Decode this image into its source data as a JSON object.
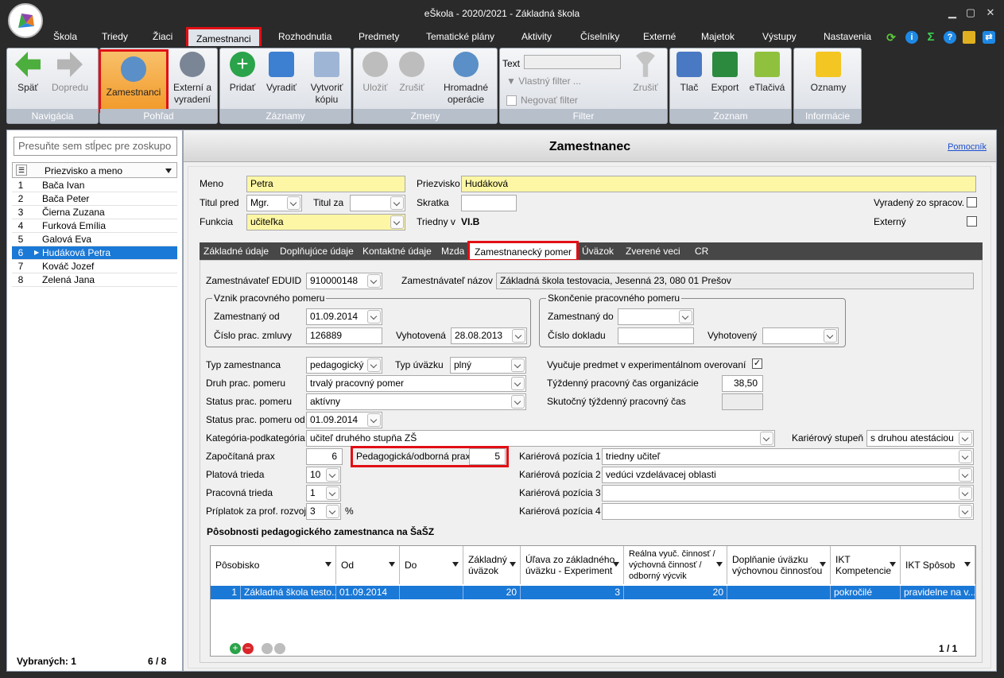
{
  "app": {
    "title": "eŠkola - 2020/2021 - Základná škola"
  },
  "menu": {
    "items": [
      "Škola",
      "Triedy",
      "Žiaci",
      "Zamestnanci",
      "Rozhodnutia",
      "Predmety",
      "Tematické plány",
      "Aktivity",
      "Číselníky",
      "Externé",
      "Majetok",
      "Výstupy",
      "Nastavenia"
    ],
    "active": "Zamestnanci"
  },
  "ribbon": {
    "navigacia": {
      "caption": "Navigácia",
      "back": "Späť",
      "forward": "Dopredu"
    },
    "pohlad": {
      "caption": "Pohľad",
      "employees": "Zamestnanci",
      "external": "Externí a vyradení"
    },
    "zaznamy": {
      "caption": "Záznamy",
      "add": "Pridať",
      "remove": "Vyradiť",
      "copy": "Vytvoriť kópiu"
    },
    "zmeny": {
      "caption": "Zmeny",
      "save": "Uložiť",
      "cancel": "Zrušiť",
      "bulk": "Hromadné operácie"
    },
    "filter": {
      "caption": "Filter",
      "text_label": "Text",
      "custom": "Vlastný filter ...",
      "negate": "Negovať filter",
      "clear": "Zrušiť"
    },
    "zoznam": {
      "caption": "Zoznam",
      "print": "Tlač",
      "export": "Export",
      "eprint": "eTlačivá"
    },
    "informacie": {
      "caption": "Informácie",
      "notices": "Oznamy"
    }
  },
  "left": {
    "group_placeholder": "Presuňte sem stĺpec pre zoskupo",
    "col_header": "Priezvisko a meno",
    "rows": [
      [
        "1",
        "Bača Ivan"
      ],
      [
        "2",
        "Bača Peter"
      ],
      [
        "3",
        "Čierna Zuzana"
      ],
      [
        "4",
        "Furková Emília"
      ],
      [
        "5",
        "Galová Eva"
      ],
      [
        "6",
        "Hudáková Petra"
      ],
      [
        "7",
        "Kováč Jozef"
      ],
      [
        "8",
        "Zelená Jana"
      ]
    ],
    "selected_label": "Vybraných: 1",
    "count": "6 / 8"
  },
  "detail": {
    "title": "Zamestnanec",
    "help": "Pomocník",
    "meno_lbl": "Meno",
    "meno": "Petra",
    "priezvisko_lbl": "Priezvisko",
    "priezvisko": "Hudáková",
    "titul_pred_lbl": "Titul pred",
    "titul_pred": "Mgr.",
    "titul_za_lbl": "Titul za",
    "titul_za": "",
    "skratka_lbl": "Skratka",
    "skratka": "",
    "vyradeny_lbl": "Vyradený zo spracov.",
    "externy_lbl": "Externý",
    "funkcia_lbl": "Funkcia",
    "funkcia": "učiteľka",
    "triedny_lbl": "Triedny v",
    "triedny": "VI.B",
    "tabs": [
      "Základné údaje",
      "Doplňujúce údaje",
      "Kontaktné údaje",
      "Mzda",
      "Zamestnanecký pomer",
      "Úväzok",
      "Zverené veci",
      "CR"
    ],
    "active_tab": "Zamestnanecký pomer"
  },
  "pomer": {
    "eduid_lbl": "Zamestnávateľ EDUID",
    "eduid": "910000148",
    "nazov_lbl": "Zamestnávateľ názov",
    "nazov": "Základná škola testovacia, Jesenná 23, 080 01 Prešov",
    "vznik_lbl": "Vznik pracovného pomeru",
    "od_lbl": "Zamestnaný od",
    "od": "01.09.2014",
    "zmluva_lbl": "Číslo prac. zmluvy",
    "zmluva": "126889",
    "vyhotovena_lbl": "Vyhotovená",
    "vyhotovena": "28.08.2013",
    "skoncenie_lbl": "Skončenie pracovného pomeru",
    "do_lbl": "Zamestnaný do",
    "do": "",
    "doklad_lbl": "Číslo dokladu",
    "doklad": "",
    "vyhotoveny_lbl": "Vyhotovený",
    "vyhotoveny": "",
    "typ_lbl": "Typ zamestnanca",
    "typ": "pedagogický",
    "typuv_lbl": "Typ úväzku",
    "typuv": "plný",
    "exp_lbl": "Vyučuje predmet v experimentálnom overovaní",
    "druh_lbl": "Druh prac. pomeru",
    "druh": "trvalý pracovný pomer",
    "tyzd_lbl": "Týždenný pracovný čas organizácie",
    "tyzd": "38,50",
    "status_lbl": "Status prac. pomeru",
    "status": "aktívny",
    "skut_lbl": "Skutočný týždenný pracovný čas",
    "skut": "",
    "statusod_lbl": "Status prac. pomeru od",
    "statusod": "01.09.2014",
    "kat_lbl": "Kategória-podkategória",
    "kat": "učiteľ druhého stupňa ZŠ",
    "kstupen_lbl": "Kariérový stupeň",
    "kstupen": "s druhou atestáciou",
    "zapoc_lbl": "Započítaná prax",
    "zapoc": "6",
    "pedprax_lbl": "Pedagogická/odborná prax",
    "pedprax": "5",
    "kp1_lbl": "Kariérová pozícia 1",
    "kp1": "triedny učiteľ",
    "kp2_lbl": "Kariérová pozícia 2",
    "kp2": "vedúci vzdelávacej oblasti",
    "kp3_lbl": "Kariérová pozícia 3",
    "kp3": "",
    "kp4_lbl": "Kariérová pozícia 4",
    "kp4": "",
    "plat_lbl": "Platová trieda",
    "plat": "10",
    "prac_lbl": "Pracovná trieda",
    "prac": "1",
    "priplatok_lbl": "Príplatok za prof. rozvoj",
    "priplatok": "3",
    "pct": "%",
    "posob_title": "Pôsobnosti pedagogického zamestnanca na ŠaŠZ",
    "grid_cols": [
      "Pôsobisko",
      "Od",
      "Do",
      "Základný úväzok",
      "Úľava zo základného úväzku - Experiment",
      "Reálna vyuč. činnosť / výchovná činnosť / odborný výcvik",
      "Doplňanie úväzku výchovnou činnosťou",
      "IKT Kompetencie",
      "IKT Spôsob"
    ],
    "grid_row": {
      "n": "1",
      "posobisko": "Základná škola testo...",
      "od": "01.09.2014",
      "do": "",
      "zakl": "20",
      "ulava": "3",
      "realna": "20",
      "dopl": "",
      "ikt_k": "pokročilé",
      "ikt_s": "pravidelne na v..."
    },
    "pager": "1 / 1"
  }
}
